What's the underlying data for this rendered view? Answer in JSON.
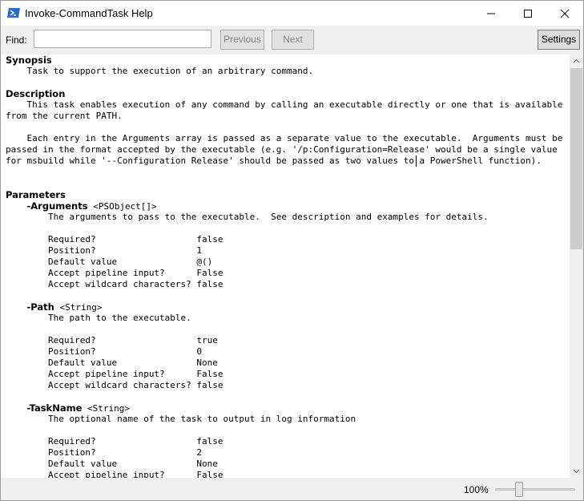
{
  "window": {
    "title": "Invoke-CommandTask Help",
    "icon": "powershell-icon",
    "controls": [
      "minimize-icon",
      "maximize-icon",
      "close-icon"
    ]
  },
  "findbar": {
    "label": "Find:",
    "value": "",
    "previous_label": "Previous",
    "next_label": "Next",
    "settings_label": "Settings"
  },
  "help": {
    "synopsis_heading": "Synopsis",
    "synopsis": "    Task to support the execution of an arbitrary command.",
    "description_heading": "Description",
    "description_lines": [
      "    This task enables execution of any command by calling an executable directly or one that is available",
      "from the current PATH.",
      "",
      "    Each entry in the Arguments array is passed as a separate value to the executable.  Arguments must be",
      "passed in the format accepted by the executable (e.g. '/p:Configuration=Release' would be a single value",
      "for msbuild while '--Configuration Release' should be passed as two values to a PowerShell function)."
    ],
    "parameters_heading": "Parameters",
    "parameters": [
      {
        "name": "-Arguments",
        "type": "<PSObject[]>",
        "description": "The arguments to pass to the executable.  See description and examples for details.",
        "required": "false",
        "position": "1",
        "default_value": "@()",
        "accept_pipeline": "False",
        "accept_wildcard": "false"
      },
      {
        "name": "-Path",
        "type": "<String>",
        "description": "The path to the executable.",
        "required": "true",
        "position": "0",
        "default_value": "None",
        "accept_pipeline": "False",
        "accept_wildcard": "false"
      },
      {
        "name": "-TaskName",
        "type": "<String>",
        "description": "The optional name of the task to output in log information",
        "required": "false",
        "position": "2",
        "default_value": "None",
        "accept_pipeline": "False",
        "accept_wildcard": "false"
      }
    ],
    "labels": {
      "required": "Required?                   ",
      "position": "Position?                   ",
      "default_value": "Default value               ",
      "accept_pipeline": "Accept pipeline input?      ",
      "accept_wildcard": "Accept wildcard characters? "
    }
  },
  "status": {
    "zoom": "100%",
    "zoom_slider_fraction": 0.25
  },
  "colors": {
    "window_bg": "#ffffff",
    "chrome_bg": "#f0f0f0",
    "powershell_blue": "#2a6acf"
  }
}
